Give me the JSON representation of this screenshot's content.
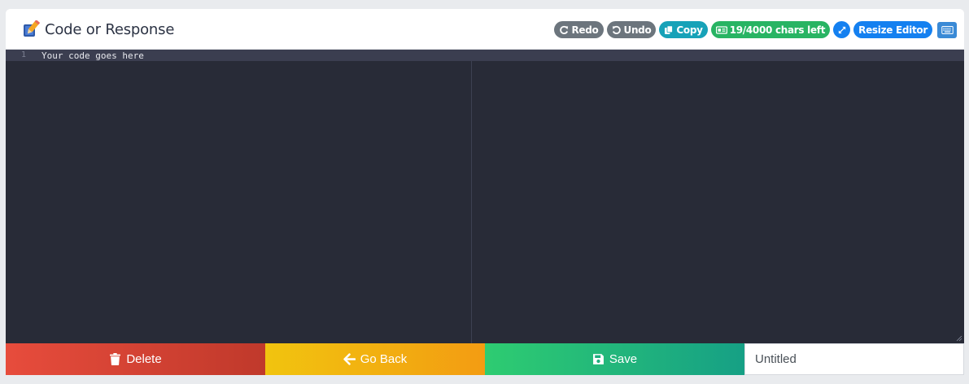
{
  "header": {
    "title": "Code or Response",
    "title_icon": "pencil-edit-icon"
  },
  "toolbar": {
    "redo_label": "Redo",
    "undo_label": "Undo",
    "copy_label": "Copy",
    "chars_left_label": "19/4000 chars left",
    "resize_editor_label": "Resize Editor",
    "icons": [
      "redo-icon",
      "undo-icon",
      "copy-icon",
      "chars-counter-icon",
      "expand-icon",
      "keyboard-icon"
    ]
  },
  "editor": {
    "line_numbers": [
      "1"
    ],
    "lines": [
      "Your code goes here"
    ],
    "background": "#282b37",
    "active_line_background": "#3b3e50"
  },
  "footer": {
    "delete_label": "Delete",
    "go_back_label": "Go Back",
    "save_label": "Save",
    "name_value": "Untitled"
  },
  "colors": {
    "delete": "#e74c3c",
    "go_back": "#f1c40f",
    "save": "#2ecc71",
    "badge_gray": "#6c757d",
    "badge_teal": "#17a2b8",
    "badge_green": "#28b463",
    "badge_blue": "#1480f0"
  }
}
